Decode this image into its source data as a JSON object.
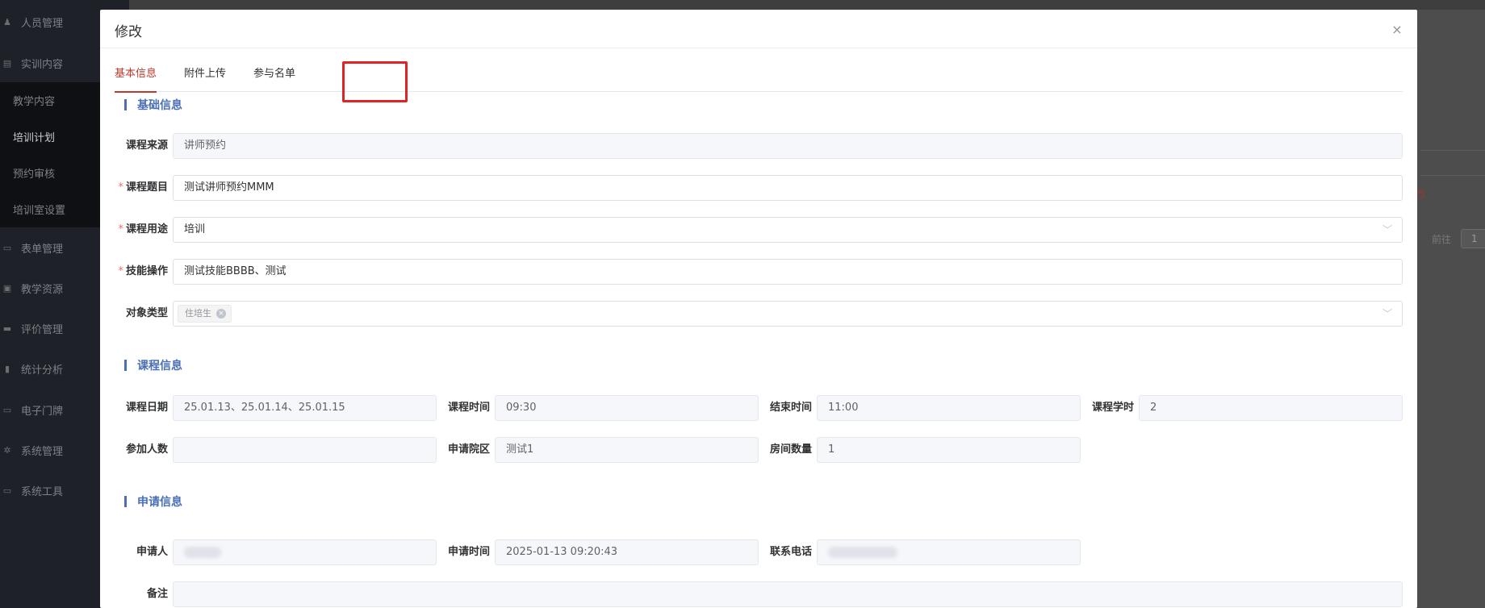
{
  "sidebar": {
    "items": [
      {
        "label": "人员管理",
        "icon": "people-icon"
      },
      {
        "label": "实训内容",
        "icon": "book-icon"
      },
      {
        "label": "表单管理",
        "icon": "form-icon"
      },
      {
        "label": "教学资源",
        "icon": "resource-icon"
      },
      {
        "label": "评价管理",
        "icon": "evaluation-icon"
      },
      {
        "label": "统计分析",
        "icon": "chart-icon"
      },
      {
        "label": "电子门牌",
        "icon": "doorplate-icon"
      },
      {
        "label": "系统管理",
        "icon": "gear-icon"
      },
      {
        "label": "系统工具",
        "icon": "tool-icon"
      }
    ],
    "subitems": [
      "教学内容",
      "培训计划",
      "预约审核",
      "培训室设置"
    ]
  },
  "background": {
    "edit_text": "改",
    "goto_label": "前往",
    "page_number": "1"
  },
  "modal": {
    "title": "修改",
    "close": "×",
    "tabs": [
      "基本信息",
      "附件上传",
      "参与名单"
    ],
    "active_tab": 0,
    "highlighted_tab": 2
  },
  "sections": {
    "basic": "基础信息",
    "course": "课程信息",
    "apply": "申请信息"
  },
  "basic_form": {
    "course_source": {
      "label": "课程来源",
      "value": "讲师预约",
      "disabled": true
    },
    "course_topic": {
      "label": "课程题目",
      "value": "测试讲师预约MMM",
      "required": true
    },
    "course_usage": {
      "label": "课程用途",
      "value": "培训",
      "required": true
    },
    "skill_operation": {
      "label": "技能操作",
      "value": "测试技能BBBB、测试",
      "required": true
    },
    "object_type": {
      "label": "对象类型",
      "tags": [
        "住培生"
      ]
    }
  },
  "course_form": {
    "course_date": {
      "label": "课程日期",
      "value": "25.01.13、25.01.14、25.01.15"
    },
    "course_time": {
      "label": "课程时间",
      "value": "09:30"
    },
    "end_time": {
      "label": "结束时间",
      "value": "11:00"
    },
    "course_hours": {
      "label": "课程学时",
      "value": "2"
    },
    "participants": {
      "label": "参加人数",
      "value": ""
    },
    "apply_hospital": {
      "label": "申请院区",
      "value": "测试1"
    },
    "room_count": {
      "label": "房间数量",
      "value": "1"
    }
  },
  "apply_form": {
    "applicant": {
      "label": "申请人"
    },
    "apply_time": {
      "label": "申请时间",
      "value": "2025-01-13 09:20:43"
    },
    "phone": {
      "label": "联系电话"
    },
    "remark": {
      "label": "备注",
      "value": ""
    }
  },
  "colors": {
    "accent": "#c0392b",
    "section": "#4a6fb5",
    "highlight_box": "#e02424"
  }
}
